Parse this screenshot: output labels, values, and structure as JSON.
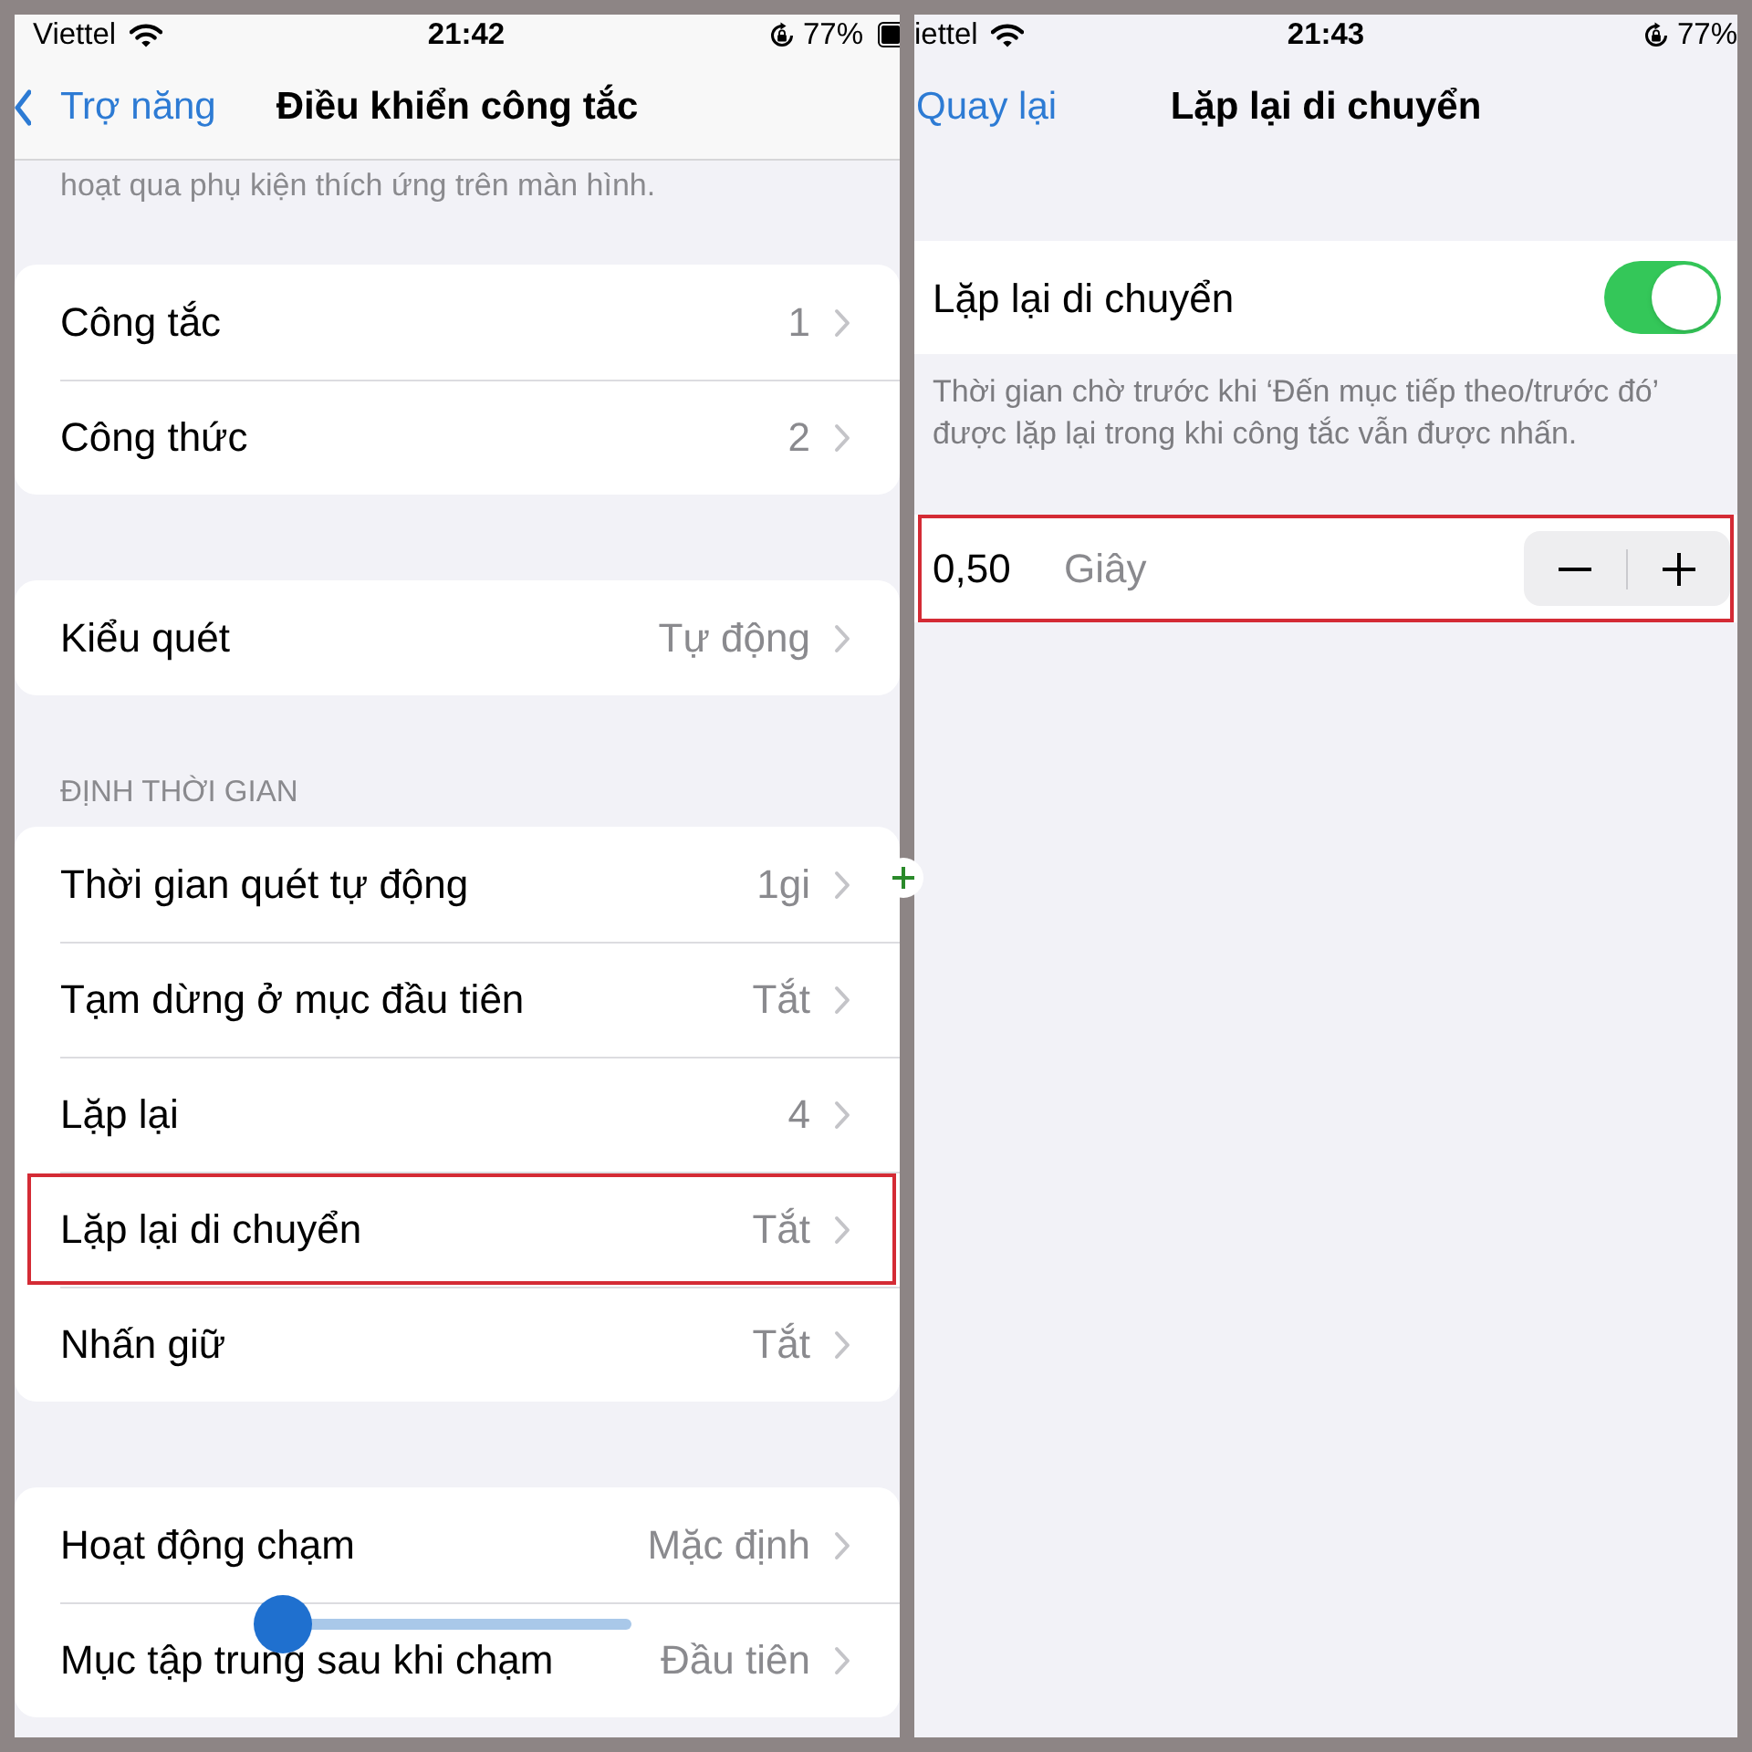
{
  "left_screen": {
    "status_bar": {
      "carrier": "Viettel",
      "time": "21:42",
      "battery": "77%"
    },
    "nav": {
      "back": "Trợ năng",
      "title": "Điều khiển công tắc"
    },
    "intro_text": "hoạt qua phụ kiện thích ứng trên màn hình.",
    "groups": [
      {
        "rows": [
          {
            "label": "Công tắc",
            "value": "1",
            "highlighted": false
          },
          {
            "label": "Công thức",
            "value": "2",
            "highlighted": false
          }
        ]
      },
      {
        "rows": [
          {
            "label": "Kiểu quét",
            "value": "Tự động",
            "highlighted": false
          }
        ]
      },
      {
        "header": "ĐỊNH THỜI GIAN",
        "rows": [
          {
            "label": "Thời gian quét tự động",
            "value": "1gi",
            "highlighted": false
          },
          {
            "label": "Tạm dừng ở mục đầu tiên",
            "value": "Tắt",
            "highlighted": false
          },
          {
            "label": "Lặp lại",
            "value": "4",
            "highlighted": false
          },
          {
            "label": "Lặp lại di chuyển",
            "value": "Tắt",
            "highlighted": true
          },
          {
            "label": "Nhấn giữ",
            "value": "Tắt",
            "highlighted": false
          }
        ]
      },
      {
        "rows": [
          {
            "label": "Hoạt động chạm",
            "value": "Mặc định",
            "highlighted": false
          },
          {
            "label": "Mục tập trung sau khi chạm",
            "value": "Đầu tiên",
            "highlighted": false
          }
        ]
      }
    ],
    "slider": {
      "level": 0
    }
  },
  "right_screen": {
    "status_bar": {
      "carrier": "iettel",
      "time": "21:43",
      "battery": "77%"
    },
    "nav": {
      "back": "Quay lại",
      "title": "Lặp lại di chuyển"
    },
    "toggle_row": {
      "label": "Lặp lại di chuyển",
      "on": true
    },
    "footer": "Thời gian chờ trước khi ‘Đến mục tiếp theo/trước đó’ được lặp lại trong khi công tắc vẫn được nhấn.",
    "stepper_row": {
      "value": "0,50",
      "unit": "Giây",
      "highlighted": true
    }
  }
}
